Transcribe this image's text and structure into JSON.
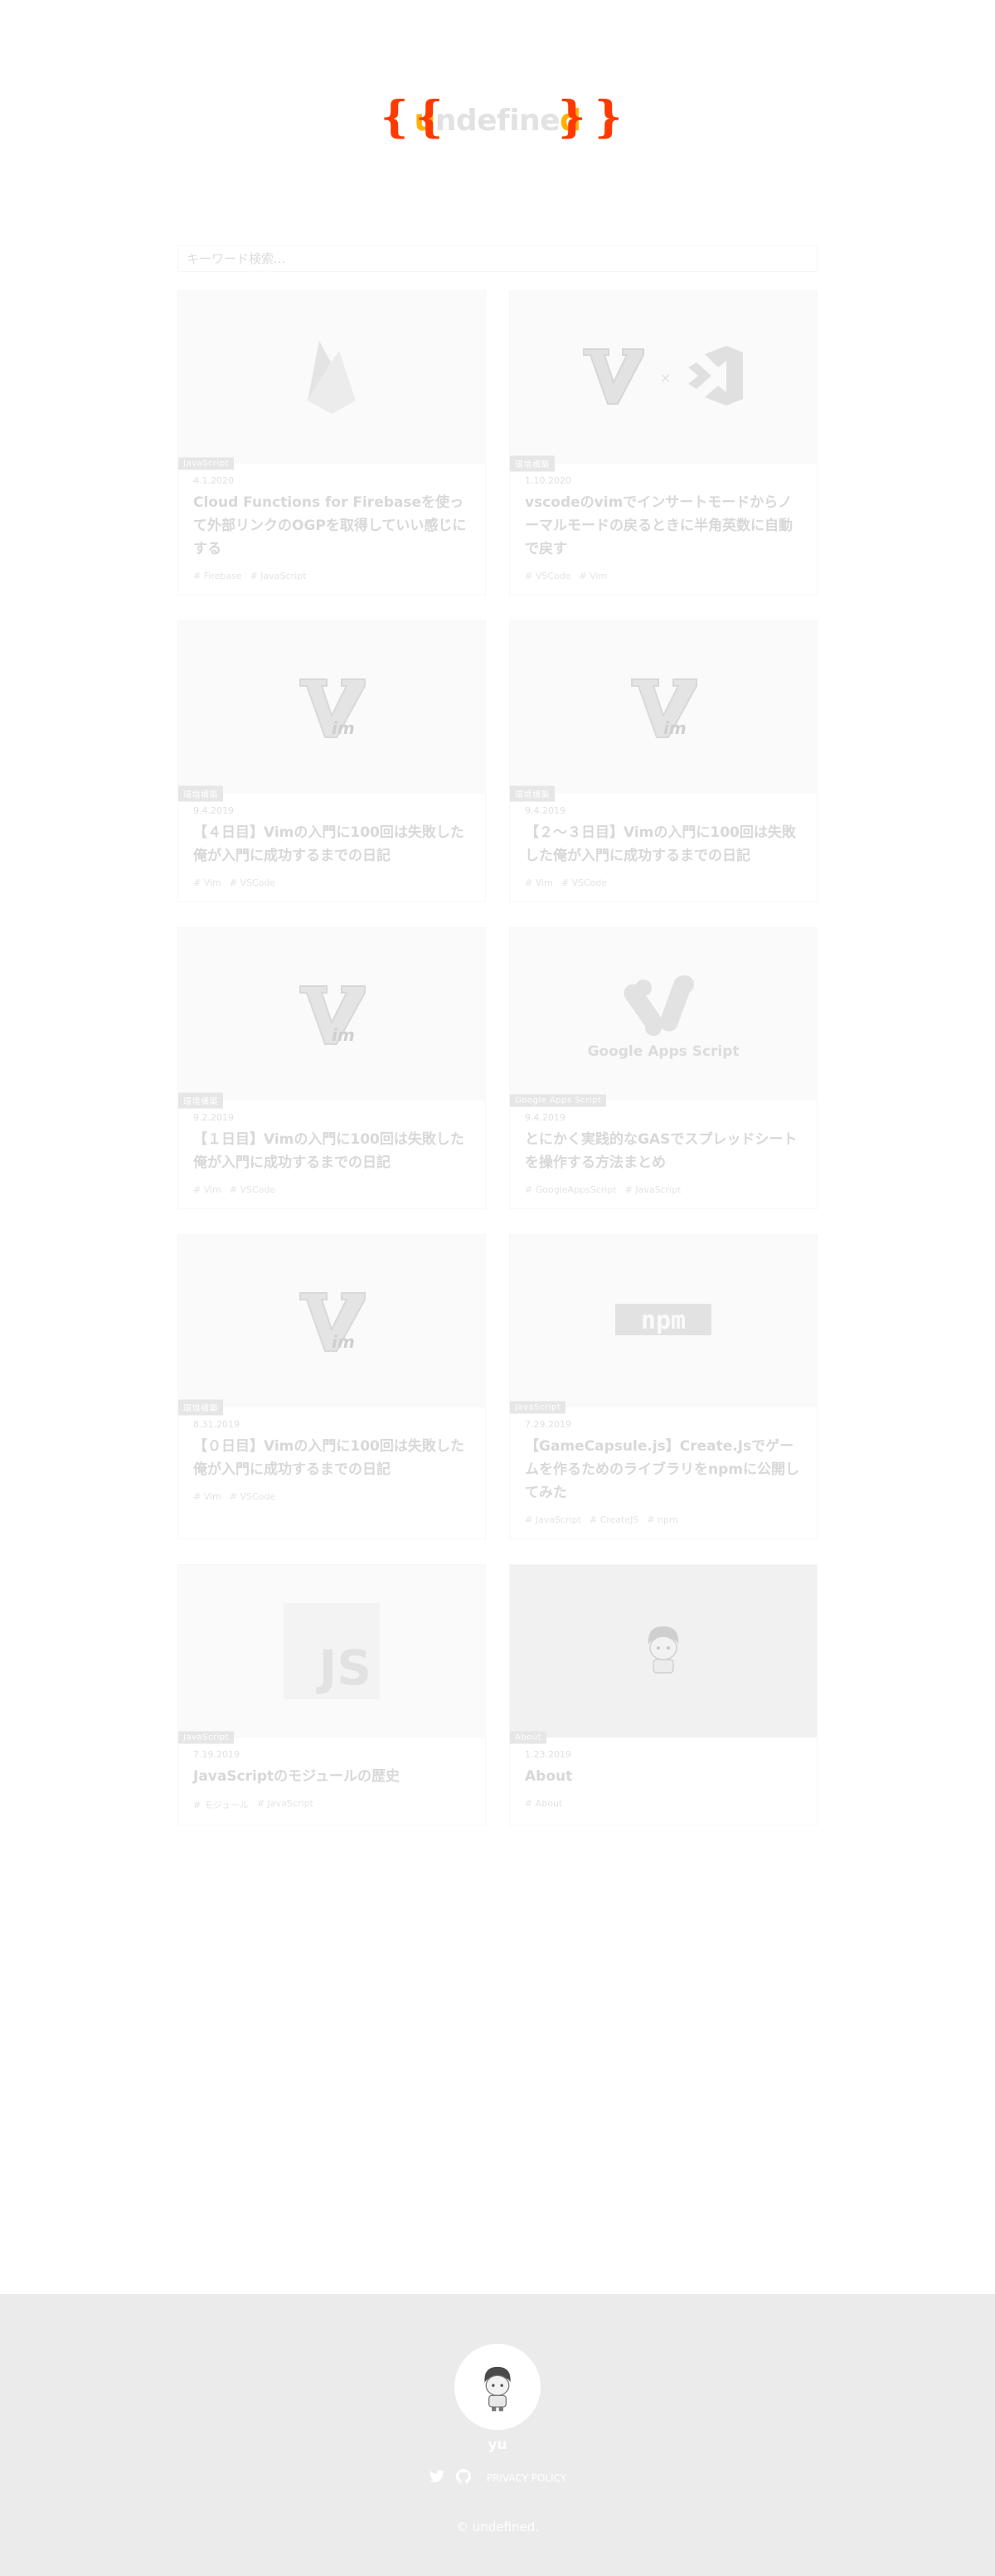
{
  "header": {
    "logo_prefix": "{ {",
    "logo_text_u": "u",
    "logo_text_rest": "ndefine",
    "logo_text_d": "d",
    "logo_suffix": "} }",
    "brace_color": "#ff3a00"
  },
  "search": {
    "placeholder": "キーワード検索..."
  },
  "posts": [
    {
      "category": "JavaScript",
      "date": "4.1.2020",
      "title": "Cloud Functions for Firebaseを使って外部リンクのOGPを取得していい感じにする",
      "tags": [
        "# Firebase",
        "# JavaScript"
      ],
      "icon": "firebase-icon"
    },
    {
      "category": "環境構築",
      "date": "1.10.2020",
      "title": "vscodeのvimでインサートモードからノーマルモードの戻るときに半角英数に自動で戻す",
      "tags": [
        "# VSCode",
        "# Vim"
      ],
      "icon": "vim-vscode-icon"
    },
    {
      "category": "環境構築",
      "date": "9.4.2019",
      "title": "【４日目】Vimの入門に100回は失敗した俺が入門に成功するまでの日記",
      "tags": [
        "# Vim",
        "# VSCode"
      ],
      "icon": "vim-icon"
    },
    {
      "category": "環境構築",
      "date": "9.4.2019",
      "title": "【２〜３日目】Vimの入門に100回は失敗した俺が入門に成功するまでの日記",
      "tags": [
        "# Vim",
        "# VSCode"
      ],
      "icon": "vim-icon"
    },
    {
      "category": "環境構築",
      "date": "9.2.2019",
      "title": "【１日目】Vimの入門に100回は失敗した俺が入門に成功するまでの日記",
      "tags": [
        "# Vim",
        "# VSCode"
      ],
      "icon": "vim-icon"
    },
    {
      "category": "Google Apps Script",
      "date": "9.4.2019",
      "title": "とにかく実践的なGASでスプレッドシートを操作する方法まとめ",
      "tags": [
        "# GoogleAppsScript",
        "# JavaScript"
      ],
      "icon": "google-apps-script-icon"
    },
    {
      "category": "環境構築",
      "date": "8.31.2019",
      "title": "【０日目】Vimの入門に100回は失敗した俺が入門に成功するまでの日記",
      "tags": [
        "# Vim",
        "# VSCode"
      ],
      "icon": "vim-icon"
    },
    {
      "category": "JavaScript",
      "date": "7.29.2019",
      "title": "【GameCapsule.js】Create.Jsでゲームを作るためのライブラリをnpmに公開してみた",
      "tags": [
        "# JavaScript",
        "# CreateJS",
        "# npm"
      ],
      "icon": "npm-icon"
    },
    {
      "category": "JavaScript",
      "date": "7.19.2019",
      "title": "JavaScriptのモジュールの歴史",
      "tags": [
        "# モジュール",
        "# JavaScript"
      ],
      "icon": "javascript-icon"
    },
    {
      "category": "About",
      "date": "1.23.2019",
      "title": "About",
      "tags": [
        "# About"
      ],
      "icon": "avatar-icon"
    }
  ],
  "footer": {
    "name": "yu",
    "privacy_label": "PRIVACY POLICY",
    "copyright": "© undefined."
  }
}
